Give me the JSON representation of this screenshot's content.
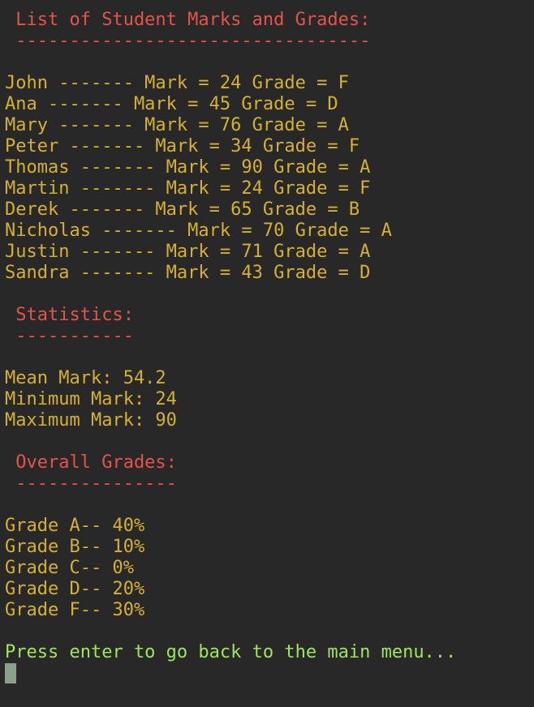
{
  "students_section": {
    "title": " List of Student Marks and Grades:",
    "underline": " ---------------------------------"
  },
  "students": [
    {
      "line": "John ------- Mark = 24 Grade = F"
    },
    {
      "line": "Ana ------- Mark = 45 Grade = D"
    },
    {
      "line": "Mary ------- Mark = 76 Grade = A"
    },
    {
      "line": "Peter ------- Mark = 34 Grade = F"
    },
    {
      "line": "Thomas ------- Mark = 90 Grade = A"
    },
    {
      "line": "Martin ------- Mark = 24 Grade = F"
    },
    {
      "line": "Derek ------- Mark = 65 Grade = B"
    },
    {
      "line": "Nicholas ------- Mark = 70 Grade = A"
    },
    {
      "line": "Justin ------- Mark = 71 Grade = A"
    },
    {
      "line": "Sandra ------- Mark = 43 Grade = D"
    }
  ],
  "statistics": {
    "title": " Statistics:",
    "underline": " -----------",
    "mean": "Mean Mark: 54.2",
    "minimum": "Minimum Mark: 24",
    "maximum": "Maximum Mark: 90"
  },
  "overall_grades": {
    "title": " Overall Grades:",
    "underline": " ---------------",
    "lines": [
      "Grade A-- 40%",
      "Grade B-- 10%",
      "Grade C-- 0%",
      "Grade D-- 20%",
      "Grade F-- 30%"
    ]
  },
  "prompt": "Press enter to go back to the main menu..."
}
